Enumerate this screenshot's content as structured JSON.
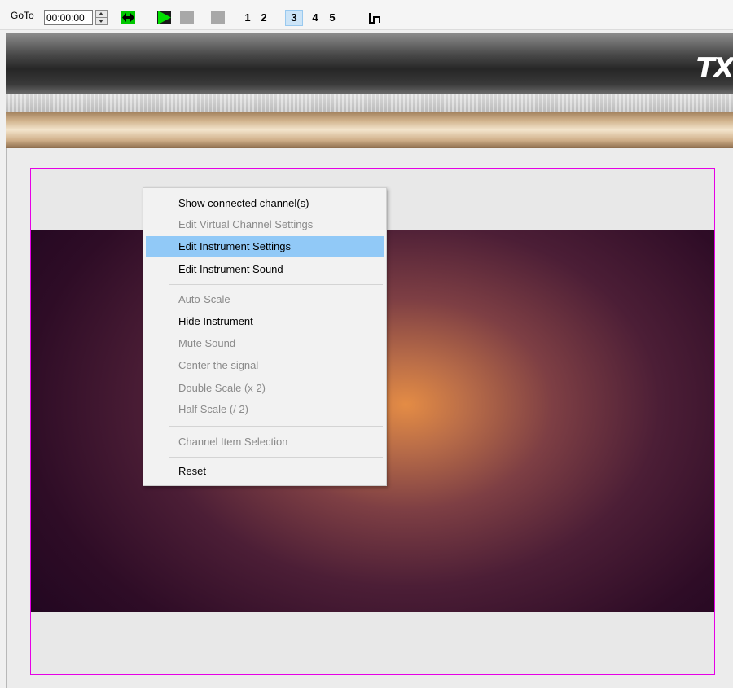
{
  "toolbar": {
    "goto_label": "GoTo",
    "time_value": "00:00:00",
    "page_buttons": [
      "1",
      "2",
      "3",
      "4",
      "5"
    ],
    "active_page": "3"
  },
  "banner": {
    "logo_text": "TX"
  },
  "context_menu": {
    "items": [
      {
        "label": "Show connected channel(s)",
        "enabled": true
      },
      {
        "label": "Edit Virtual Channel Settings",
        "enabled": false
      },
      {
        "label": "Edit Instrument Settings",
        "enabled": true,
        "highlighted": true
      },
      {
        "label": "Edit Instrument Sound",
        "enabled": true
      },
      {
        "label": "Auto-Scale",
        "enabled": false
      },
      {
        "label": "Hide Instrument",
        "enabled": true
      },
      {
        "label": "Mute Sound",
        "enabled": false
      },
      {
        "label": "Center the signal",
        "enabled": false
      },
      {
        "label": "Double Scale (x 2)",
        "enabled": false
      },
      {
        "label": "Half Scale (/ 2)",
        "enabled": false
      },
      {
        "label": "Channel Item Selection",
        "enabled": false
      },
      {
        "label": "Reset",
        "enabled": true
      }
    ]
  },
  "colors": {
    "instrument_border": "#e600e6",
    "menu_highlight": "#91c9f7",
    "play_green": "#00c800"
  }
}
